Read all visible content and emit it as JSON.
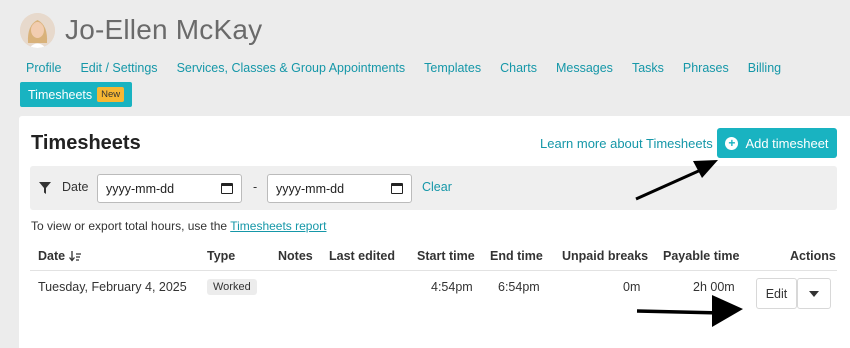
{
  "profile": {
    "name": "Jo-Ellen McKay"
  },
  "nav": {
    "items": [
      "Profile",
      "Edit / Settings",
      "Services, Classes & Group Appointments",
      "Templates",
      "Charts",
      "Messages",
      "Tasks",
      "Phrases",
      "Billing"
    ],
    "active": {
      "label": "Timesheets",
      "badge": "New"
    }
  },
  "page": {
    "title": "Timesheets",
    "learn_more": "Learn more about Timesheets",
    "add_button": "Add timesheet"
  },
  "filter": {
    "label": "Date",
    "from_placeholder": "yyyy-mm-dd",
    "to_placeholder": "yyyy-mm-dd",
    "separator": "-",
    "clear": "Clear"
  },
  "note": {
    "text": "To view or export total hours, use the ",
    "link": "Timesheets report"
  },
  "table": {
    "headers": [
      "Date",
      "Type",
      "Notes",
      "Last edited",
      "Start time",
      "End time",
      "Unpaid breaks",
      "Payable time",
      "Actions"
    ],
    "rows": [
      {
        "date": "Tuesday, February 4, 2025",
        "type": "Worked",
        "notes": "",
        "last_edited": "",
        "start": "4:54pm",
        "end": "6:54pm",
        "unpaid_breaks": "0m",
        "payable": "2h 00m",
        "edit": "Edit"
      }
    ]
  },
  "colors": {
    "accent": "#19b3c1",
    "link": "#1597a8",
    "badge": "#f7b733"
  }
}
